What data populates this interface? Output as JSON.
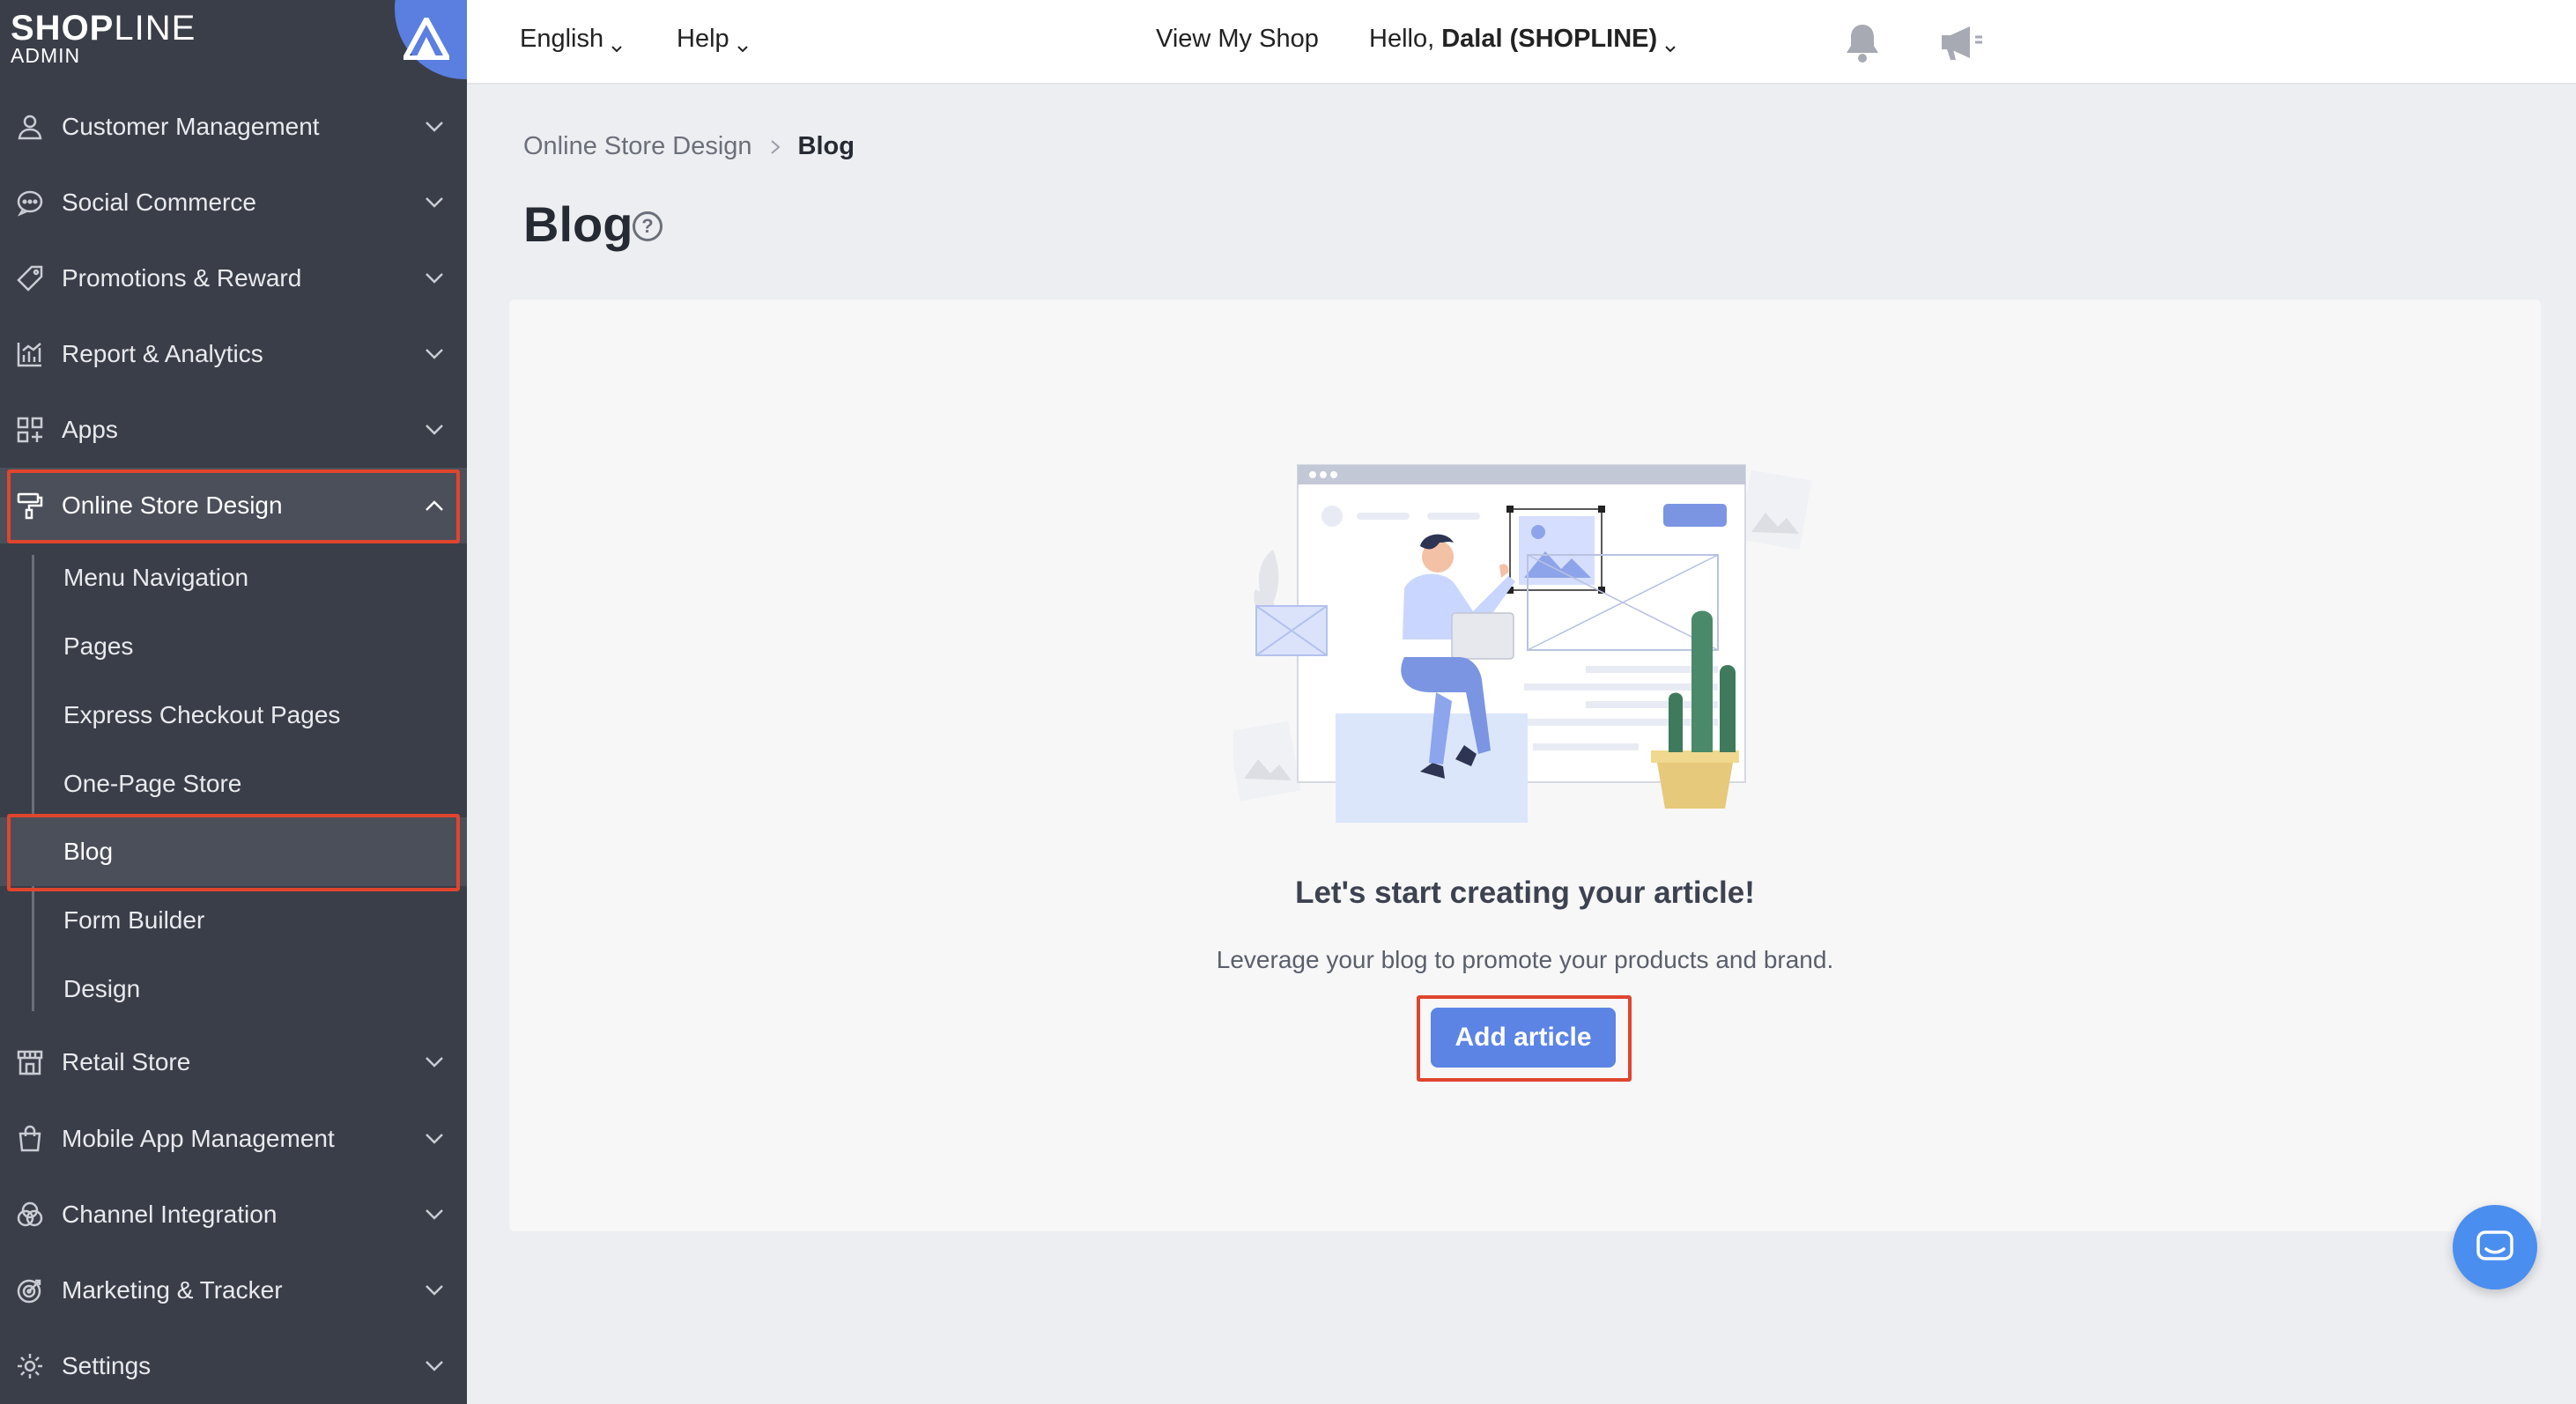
{
  "brand": {
    "logo_bold": "SHOP",
    "logo_thin": "LINE",
    "logo_sub": "ADMIN"
  },
  "sidebar": {
    "items": [
      {
        "label": "Customer Management",
        "icon": "user-icon"
      },
      {
        "label": "Social Commerce",
        "icon": "chat-bubble-icon"
      },
      {
        "label": "Promotions & Reward",
        "icon": "tag-icon"
      },
      {
        "label": "Report & Analytics",
        "icon": "bar-chart-icon"
      },
      {
        "label": "Apps",
        "icon": "apps-grid-icon"
      },
      {
        "label": "Online Store Design",
        "icon": "paint-roller-icon",
        "expanded": true
      },
      {
        "label": "Retail Store",
        "icon": "store-icon"
      },
      {
        "label": "Mobile App Management",
        "icon": "shopping-bag-icon"
      },
      {
        "label": "Channel Integration",
        "icon": "channel-circles-icon"
      },
      {
        "label": "Marketing & Tracker",
        "icon": "target-icon"
      },
      {
        "label": "Settings",
        "icon": "gear-icon"
      }
    ],
    "subitems": [
      {
        "label": "Menu Navigation"
      },
      {
        "label": "Pages"
      },
      {
        "label": "Express Checkout Pages"
      },
      {
        "label": "One-Page Store"
      },
      {
        "label": "Blog",
        "active": true
      },
      {
        "label": "Form Builder"
      },
      {
        "label": "Design"
      }
    ]
  },
  "topbar": {
    "language": "English",
    "help": "Help",
    "view_shop": "View My Shop",
    "greeting": "Hello, ",
    "user": "Dalal (SHOPLINE)"
  },
  "breadcrumb": {
    "parent": "Online Store Design",
    "current": "Blog"
  },
  "page": {
    "title": "Blog",
    "help_glyph": "?"
  },
  "empty_state": {
    "title": "Let's start creating your article!",
    "description": "Leverage your blog to promote your products and brand.",
    "button": "Add article"
  },
  "colors": {
    "sidebar_bg": "#3a3e48",
    "accent": "#5b84e5",
    "highlight": "#e0452e",
    "chat": "#4a8ef0"
  }
}
